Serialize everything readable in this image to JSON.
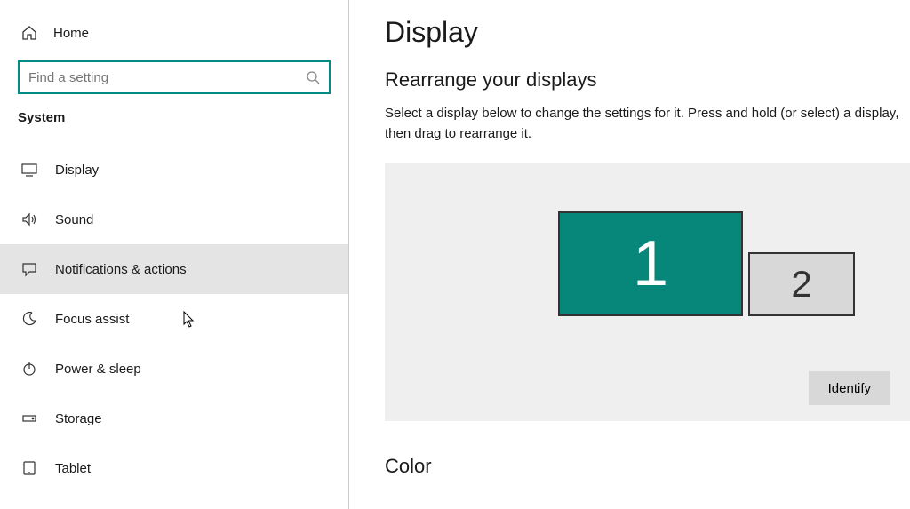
{
  "sidebar": {
    "home_label": "Home",
    "search_placeholder": "Find a setting",
    "category": "System",
    "items": [
      {
        "label": "Display",
        "icon": "monitor"
      },
      {
        "label": "Sound",
        "icon": "sound"
      },
      {
        "label": "Notifications & actions",
        "icon": "chat",
        "hovered": true
      },
      {
        "label": "Focus assist",
        "icon": "moon"
      },
      {
        "label": "Power & sleep",
        "icon": "power"
      },
      {
        "label": "Storage",
        "icon": "drive"
      },
      {
        "label": "Tablet",
        "icon": "tablet"
      }
    ]
  },
  "main": {
    "title": "Display",
    "section1_title": "Rearrange your displays",
    "section1_desc": "Select a display below to change the settings for it. Press and hold (or select) a display, then drag to rearrange it.",
    "displays": [
      {
        "number": "1",
        "primary": true
      },
      {
        "number": "2",
        "primary": false
      }
    ],
    "identify_label": "Identify",
    "section2_title": "Color"
  },
  "colors": {
    "accent": "#008c85",
    "display_selected": "#068779"
  }
}
